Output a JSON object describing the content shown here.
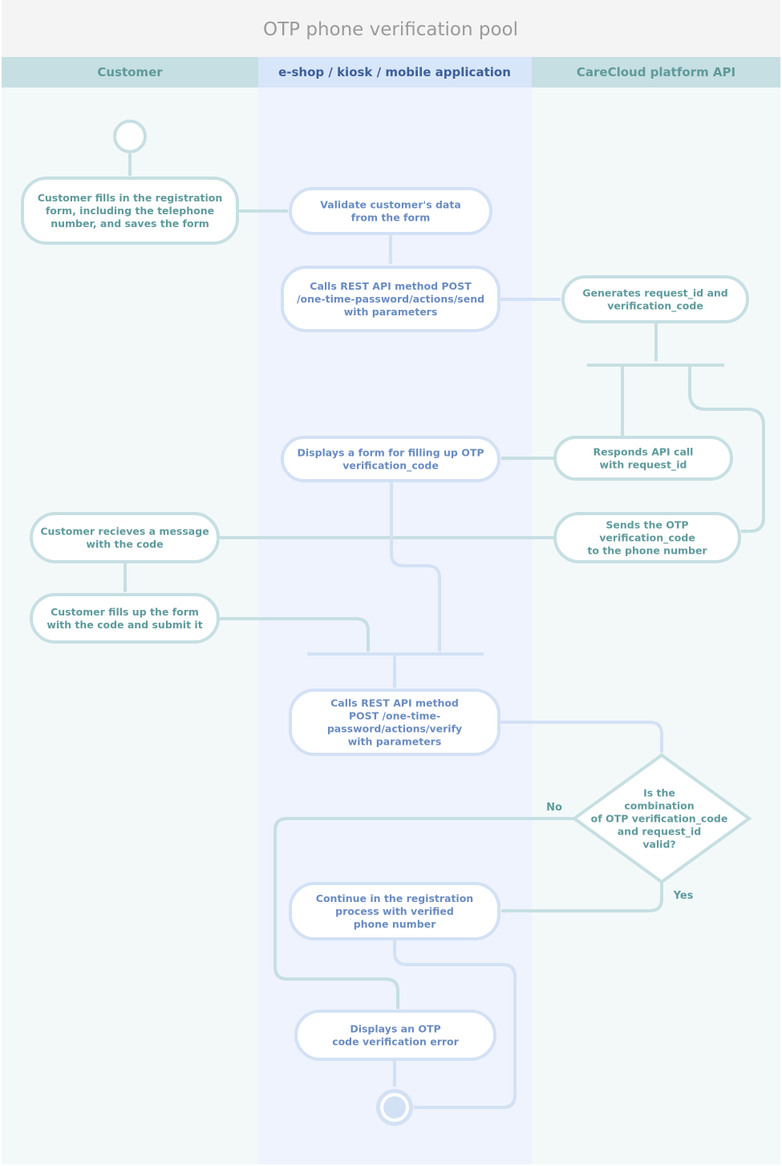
{
  "pool": {
    "title": "OTP phone verification pool"
  },
  "lanes": [
    {
      "id": "customer",
      "label": "Customer"
    },
    {
      "id": "app",
      "label": "e-shop / kiosk / mobile application"
    },
    {
      "id": "api",
      "label": "CareCloud platform API"
    }
  ],
  "colors": {
    "teal_stroke": "#c6dfe2",
    "blue_stroke": "#d3e1f5",
    "teal_text": "#5f9a9c",
    "blue_text": "#6a8cc0",
    "teal_lane_bg": "#f3f9f9",
    "blue_lane_bg": "#eef3fd",
    "teal_header_bg": "#c6dfe2",
    "blue_header_bg": "#d8e6fa",
    "title_bg": "#f4f4f4"
  },
  "nodes": {
    "start": {
      "type": "start"
    },
    "fill_form": {
      "lane": "customer",
      "lines": [
        "Customer fills in the registration",
        "form, including the telephone",
        "number, and saves the form"
      ]
    },
    "validate": {
      "lane": "app",
      "lines": [
        "Validate customer's data",
        "from the form"
      ]
    },
    "call_send": {
      "lane": "app",
      "lines": [
        "Calls REST API method POST",
        "/one-time-password/actions/send",
        "with parameters"
      ]
    },
    "generate": {
      "lane": "api",
      "lines": [
        "Generates request_id and",
        "verification_code"
      ]
    },
    "respond": {
      "lane": "api",
      "lines": [
        "Responds API call",
        "with request_id"
      ]
    },
    "display_form": {
      "lane": "app",
      "lines": [
        "Displays a form for filling up OTP",
        "verification_code"
      ]
    },
    "send_otp": {
      "lane": "api",
      "lines": [
        "Sends the OTP",
        "verification_code",
        "to the phone number"
      ]
    },
    "receive": {
      "lane": "customer",
      "lines": [
        "Customer recieves a message",
        "with the code"
      ]
    },
    "submit": {
      "lane": "customer",
      "lines": [
        "Customer fills up the form",
        "with the code and submit it"
      ]
    },
    "call_verify": {
      "lane": "app",
      "lines": [
        "Calls REST API method",
        "POST /one-time-",
        "password/actions/verify",
        "with parameters"
      ]
    },
    "decision": {
      "lane": "api",
      "lines": [
        "Is the",
        "combination",
        "of OTP verification_code",
        "and request_id",
        "valid?"
      ]
    },
    "continue": {
      "lane": "app",
      "lines": [
        "Continue in the registration",
        "process with verified",
        "phone number"
      ]
    },
    "error": {
      "lane": "app",
      "lines": [
        "Displays an OTP",
        "code verification error"
      ]
    },
    "end": {
      "type": "end"
    }
  },
  "edge_labels": {
    "no": "No",
    "yes": "Yes"
  }
}
